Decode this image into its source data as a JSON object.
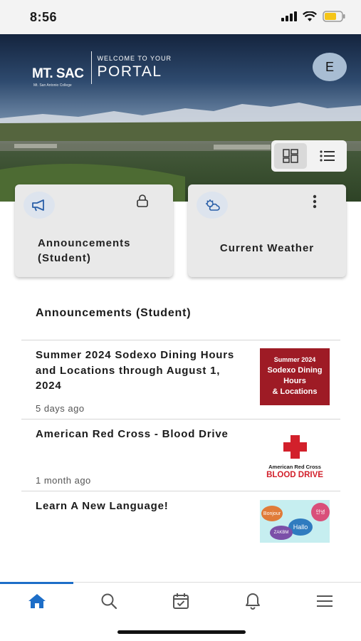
{
  "status_bar": {
    "time": "8:56"
  },
  "header": {
    "logo_mark": "MT. SAC",
    "logo_sub": "Mt. San Antonio College",
    "welcome": "WELCOME TO YOUR",
    "portal": "PORTAL",
    "avatar_initial": "E"
  },
  "cards": [
    {
      "title": "Announcements (Student)",
      "icon": "megaphone-icon"
    },
    {
      "title": "Current Weather",
      "icon": "partly-cloudy-icon"
    }
  ],
  "sheet": {
    "title": "Announcements (Student)",
    "items": [
      {
        "title": "Summer 2024 Sodexo Dining Hours and Locations through August 1, 2024",
        "time": "5 days ago",
        "thumb": {
          "line1": "Summer 2024",
          "line2": "Sodexo Dining",
          "line3": "Hours",
          "line4": "& Locations"
        }
      },
      {
        "title": "American Red Cross - Blood Drive",
        "time": "1 month ago",
        "thumb": {
          "line1": "American Red Cross",
          "line2": "BLOOD DRIVE"
        }
      },
      {
        "title": "Learn A New Language!",
        "thumb": {
          "word1": "Bonjour",
          "word2": "Hallo",
          "word3": "안녕",
          "word4": "ZAKBM"
        }
      }
    ]
  },
  "tabbar": {
    "items": [
      "home-icon",
      "search-icon",
      "calendar-check-icon",
      "bell-icon",
      "menu-icon"
    ],
    "active": 0
  },
  "colors": {
    "accent": "#1d6ec8",
    "card_bg": "#e9e9e9",
    "brand_red": "#9e1b25",
    "red_cross": "#d2202b"
  }
}
